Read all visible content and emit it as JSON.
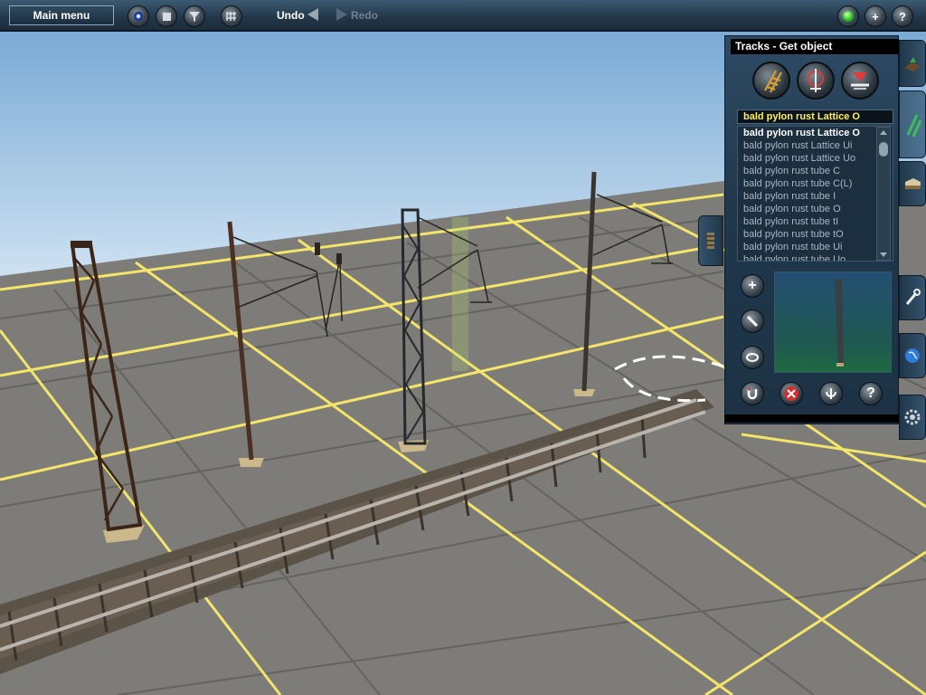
{
  "toolbar": {
    "main_menu_label": "Main menu",
    "undo_label": "Undo",
    "redo_label": "Redo",
    "help_glyph": "?",
    "add_glyph": "+"
  },
  "panel": {
    "title": "Tracks - Get object",
    "selected_item": "bald pylon rust Lattice O",
    "items": [
      "bald pylon rust Lattice O",
      "bald pylon rust Lattice Ui",
      "bald pylon rust Lattice Uo",
      "bald pylon rust tube C",
      "bald pylon rust tube C(L)",
      "bald pylon rust tube I",
      "bald pylon rust tube O",
      "bald pylon rust tube tI",
      "bald pylon rust tube tO",
      "bald pylon rust tube Ui",
      "bald pylon rust tube Uo"
    ],
    "help_glyph": "?",
    "add_glyph": "+"
  },
  "icons": {
    "view": "eye-icon",
    "stop": "stop-icon",
    "filter": "filter-icon",
    "grid": "grid-icon",
    "status": "green-light-icon",
    "add": "plus-icon",
    "help": "question-icon"
  },
  "colors": {
    "ground": "#7d7c79",
    "grid_line": "#f5e66a",
    "sky": "#b3d4ee",
    "toolbar": "#223648",
    "panel": "#20384c",
    "selected_text": "#ffef5c"
  }
}
